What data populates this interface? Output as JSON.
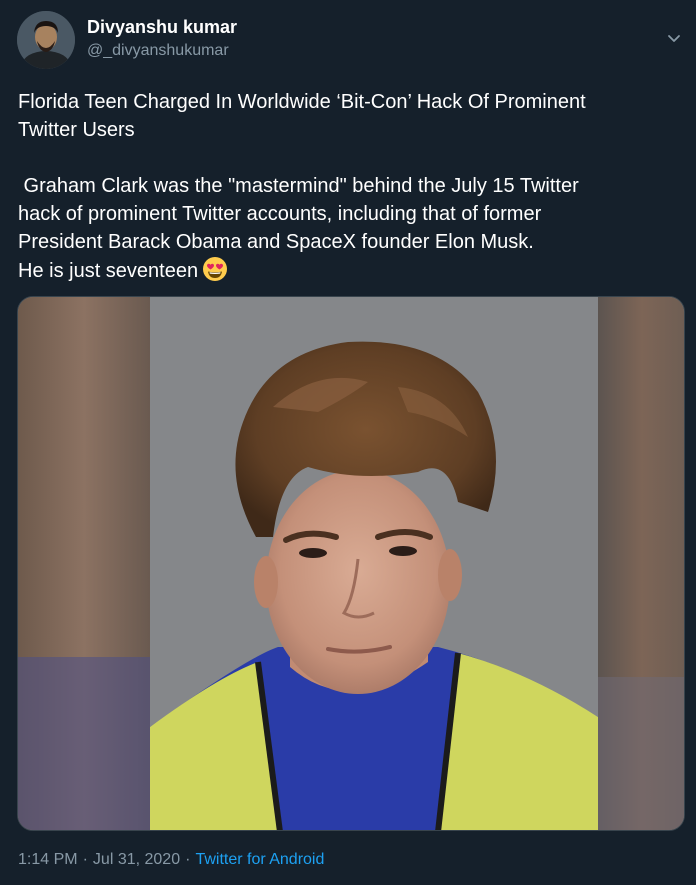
{
  "author": {
    "display_name": "Divyanshu kumar",
    "handle": "@_divyanshukumar",
    "avatar_icon": "user-avatar"
  },
  "tweet": {
    "headline_line1": "Florida Teen Charged In Worldwide ‘Bit-Con’ Hack Of Prominent",
    "headline_line2": "Twitter Users",
    "body_line1": " Graham Clark was the \"mastermind\" behind the July 15 Twitter",
    "body_line2": "hack of prominent Twitter accounts, including that of former",
    "body_line3": "President Barack Obama and SpaceX founder Elon Musk.",
    "body_line4": "He is just seventeen",
    "emoji": "heart-eyes-emoji"
  },
  "media": {
    "type": "photo",
    "icon": "mugshot-photo"
  },
  "meta": {
    "time": "1:14 PM",
    "date": "Jul 31, 2020",
    "separator": "·",
    "source": "Twitter for Android"
  },
  "colors": {
    "background": "#15202b",
    "text": "#ffffff",
    "secondary_text": "#8899a6",
    "link": "#1da1f2"
  }
}
